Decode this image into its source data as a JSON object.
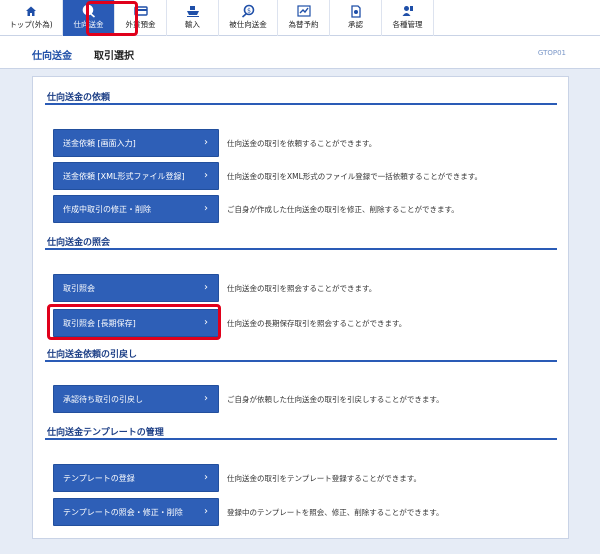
{
  "nav": {
    "items": [
      {
        "label": "トップ(外為)",
        "icon": "home-icon"
      },
      {
        "label": "仕向送金",
        "icon": "send-money-icon",
        "active": true
      },
      {
        "label": "外貨預金",
        "icon": "deposit-icon"
      },
      {
        "label": "輸入",
        "icon": "import-ship-icon"
      },
      {
        "label": "被仕向送金",
        "icon": "receive-money-icon"
      },
      {
        "label": "為替予約",
        "icon": "exchange-icon"
      },
      {
        "label": "承認",
        "icon": "approve-icon"
      },
      {
        "label": "各種管理",
        "icon": "admin-icon"
      }
    ]
  },
  "header": {
    "title": "仕向送金",
    "subtitle": "取引選択",
    "screen_code": "GTOP01"
  },
  "sections": [
    {
      "title": "仕向送金の依頼",
      "items": [
        {
          "label": "送金依頼 [画面入力]",
          "desc": "仕向送金の取引を依頼することができます。"
        },
        {
          "label": "送金依頼 [XML形式ファイル登録]",
          "desc": "仕向送金の取引をXML形式のファイル登録で一括依頼することができます。"
        },
        {
          "label": "作成中取引の修正・削除",
          "desc": "ご自身が作成した仕向送金の取引を修正、削除することができます。"
        }
      ]
    },
    {
      "title": "仕向送金の照会",
      "items": [
        {
          "label": "取引照会",
          "desc": "仕向送金の取引を照会することができます。"
        },
        {
          "label": "取引照会 [長期保存]",
          "desc": "仕向送金の長期保存取引を照会することができます。"
        }
      ]
    },
    {
      "title": "仕向送金依頼の引戻し",
      "items": [
        {
          "label": "承認待ち取引の引戻し",
          "desc": "ご自身が依頼した仕向送金の取引を引戻しすることができます。"
        }
      ]
    },
    {
      "title": "仕向送金テンプレートの管理",
      "items": [
        {
          "label": "テンプレートの登録",
          "desc": "仕向送金の取引をテンプレート登録することができます。"
        },
        {
          "label": "テンプレートの照会・修正・削除",
          "desc": "登録中のテンプレートを照会、修正、削除することができます。"
        }
      ]
    }
  ],
  "chevron": "›",
  "colors": {
    "accent": "#2e5fb7",
    "highlight": "#e0001b",
    "title": "#1d3f86"
  }
}
